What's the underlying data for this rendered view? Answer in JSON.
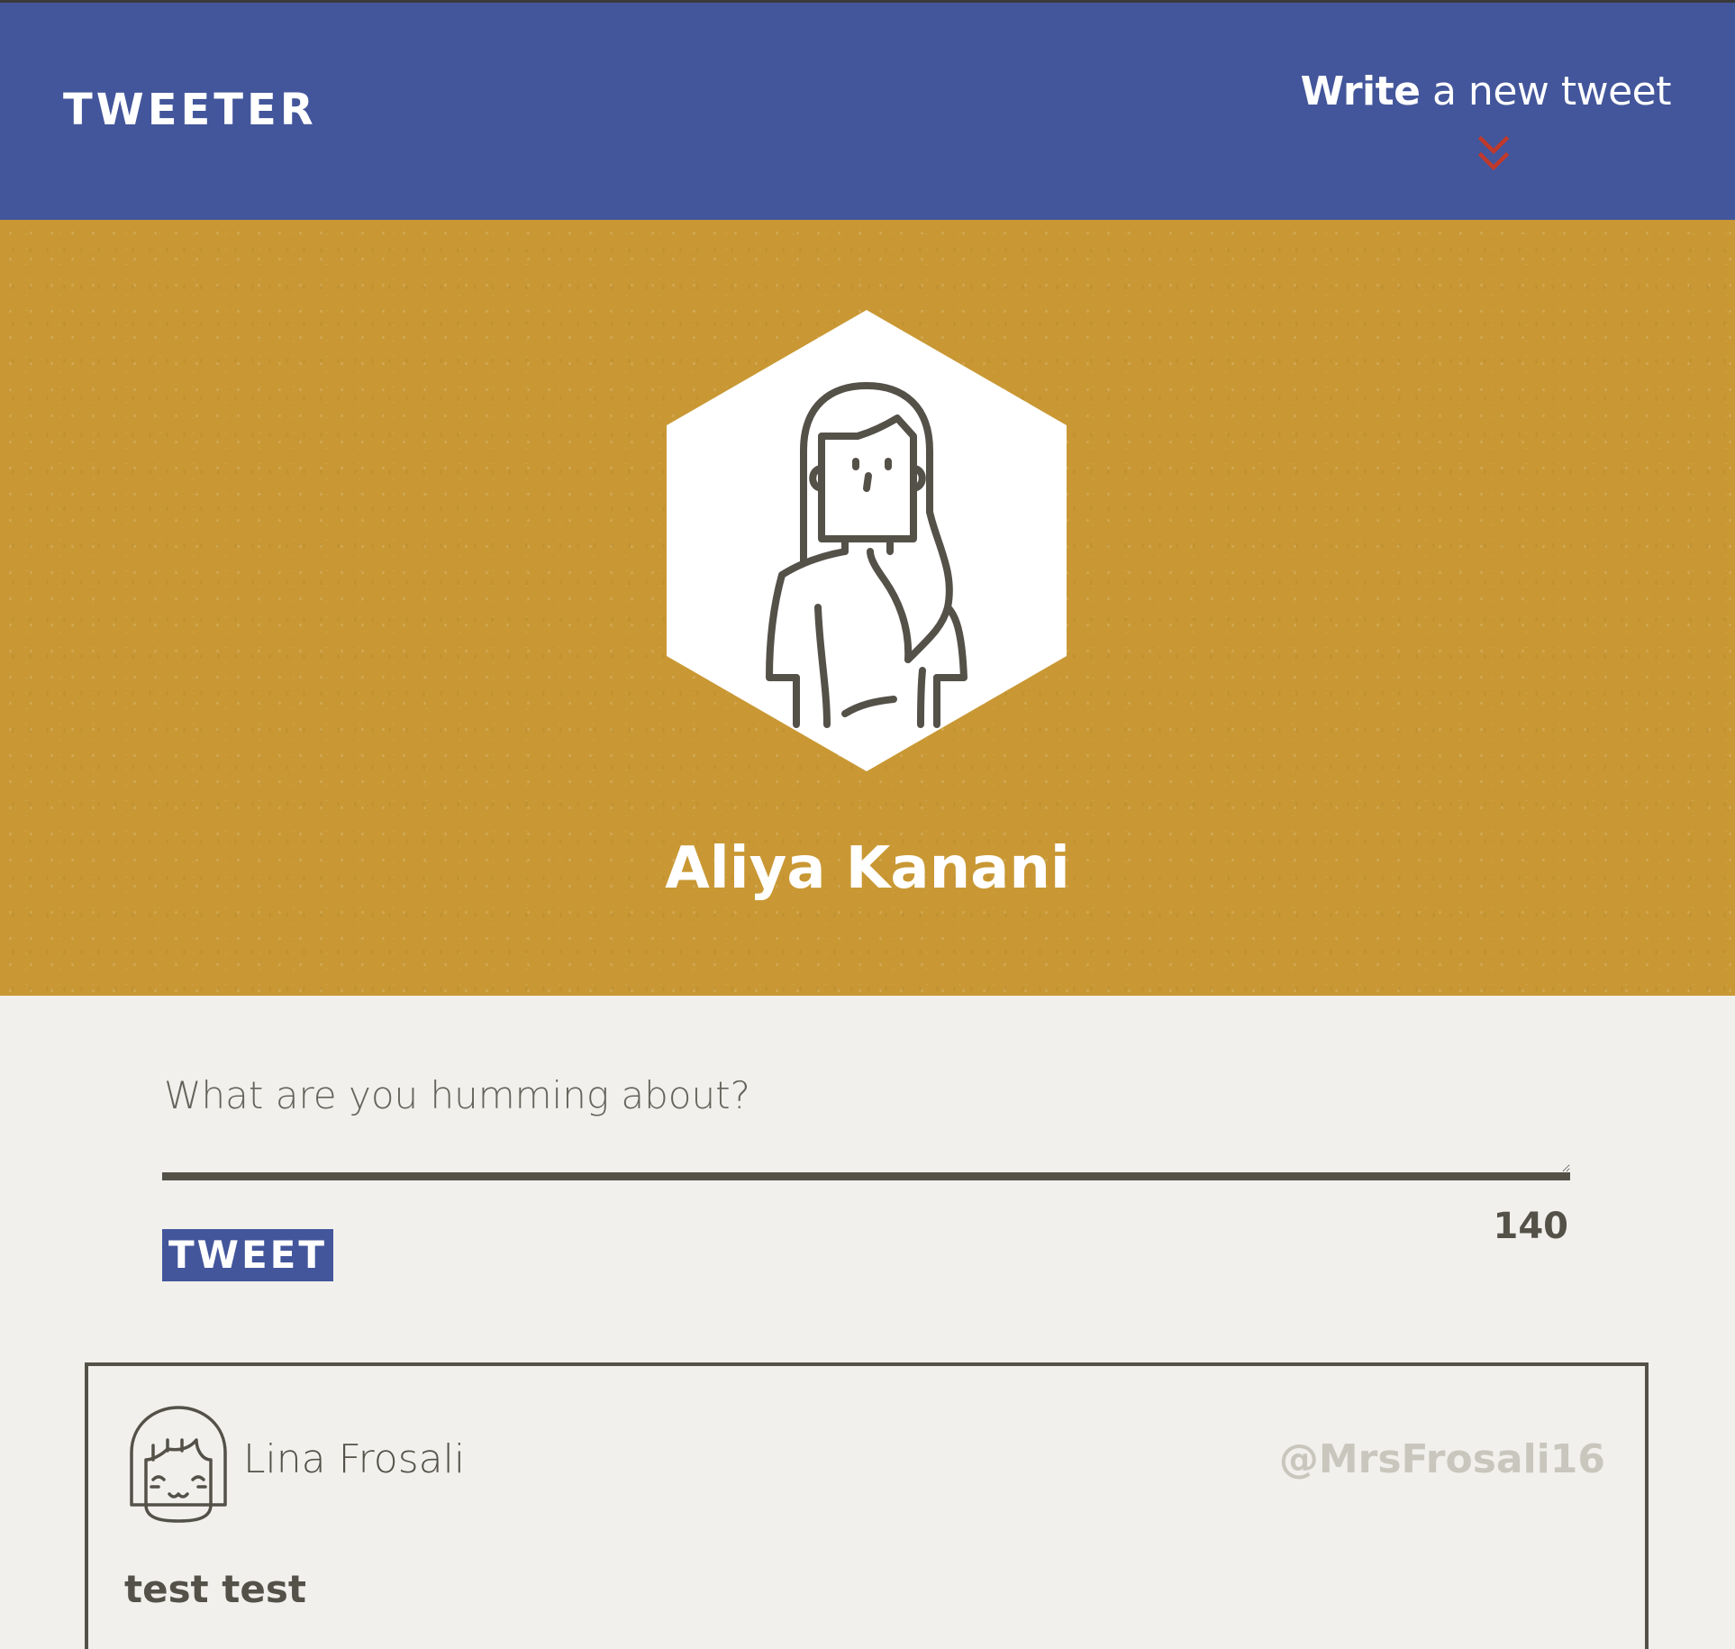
{
  "colors": {
    "nav_bg": "#43569b",
    "profile_bg": "#c99834",
    "page_bg": "#f1f0ec",
    "text_dark": "#545149",
    "handle_gray": "#c9c6bd",
    "chevron_red": "#c0392b"
  },
  "nav": {
    "brand": "TWEETER",
    "compose_bold": "Write",
    "compose_rest": " a new tweet",
    "compose_icon": "double-chevron-down-icon"
  },
  "profile": {
    "name": "Aliya Kanani",
    "avatar_icon": "woman-avatar-icon"
  },
  "composer": {
    "placeholder": "What are you humming about?",
    "value": "",
    "submit_label": "TWEET",
    "char_count": "140"
  },
  "tweets": [
    {
      "author": "Lina Frosali",
      "handle": "@MrsFrosali16",
      "text": "test test",
      "avatar_icon": "girl-avatar-icon"
    }
  ]
}
